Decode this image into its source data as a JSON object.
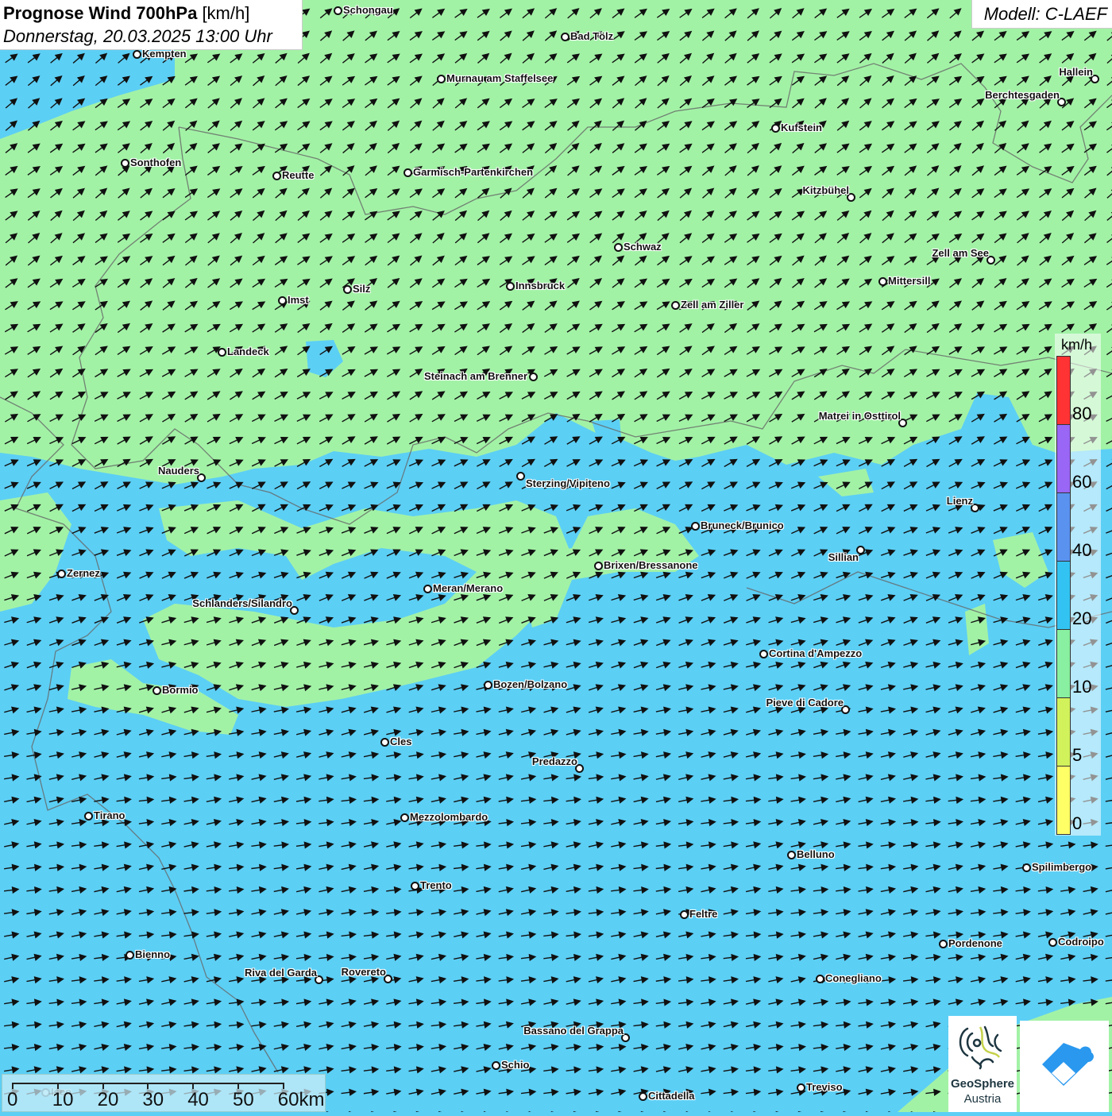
{
  "header": {
    "title_bold": "Prognose Wind 700hPa",
    "title_unit": "[km/h]",
    "datetime": "Donnerstag, 20.03.2025 13:00 Uhr",
    "model": "Modell: C-LAEF"
  },
  "colors": {
    "low_wind_green": "#a2f2a6",
    "mid_wind_blue": "#5ccff5",
    "arrow": "#111111"
  },
  "legend": {
    "unit": "km/h",
    "segments": [
      {
        "color": "#ff3333",
        "label": "80"
      },
      {
        "color": "#9966f5",
        "label": "60"
      },
      {
        "color": "#5a92f0",
        "label": "40"
      },
      {
        "color": "#33c3f2",
        "label": "20"
      },
      {
        "color": "#88f0a0",
        "label": "10"
      },
      {
        "color": "#d2f25c",
        "label": "5"
      },
      {
        "color": "#ffff66",
        "label": "0"
      }
    ]
  },
  "scale_bar": {
    "labels": [
      "0",
      "10",
      "20",
      "30",
      "40",
      "50",
      "60km"
    ]
  },
  "logos": {
    "geosphere_line1": "GeoSphere",
    "geosphere_line2": "Austria"
  },
  "cities": [
    "Schongau",
    "Bad Tölz",
    "Kempten",
    "Murnau am Staffelsee",
    "Hallein",
    "Berchtesgaden",
    "Kufstein",
    "Sonthofen",
    "Reutte",
    "Garmisch-Partenkirchen",
    "Kitzbühel",
    "Schwaz",
    "Zell am See",
    "Mittersill",
    "Innsbruck",
    "Silz",
    "Imst",
    "Zell am Ziller",
    "Landeck",
    "Steinach am Brenner",
    "Matrei in Osttirol",
    "Nauders",
    "Sterzing/Vipiteno",
    "Lienz",
    "Bruneck/Brunico",
    "Sillian",
    "Zernez",
    "Brixen/Bressanone",
    "Meran/Merano",
    "Schlanders/Silandro",
    "Cortina d'Ampezzo",
    "Bozen/Bolzano",
    "Bormio",
    "Pieve di Cadore",
    "Cles",
    "Predazzo",
    "Tirano",
    "Mezzolombardo",
    "Belluno",
    "Spilimbergo",
    "Trento",
    "Feltre",
    "Pordenone",
    "Codroipo",
    "Bienno",
    "Riva del Garda",
    "Rovereto",
    "Conegliano",
    "Bassano del Grappa",
    "Schio",
    "Treviso",
    "Cittadella",
    "Iseo"
  ]
}
